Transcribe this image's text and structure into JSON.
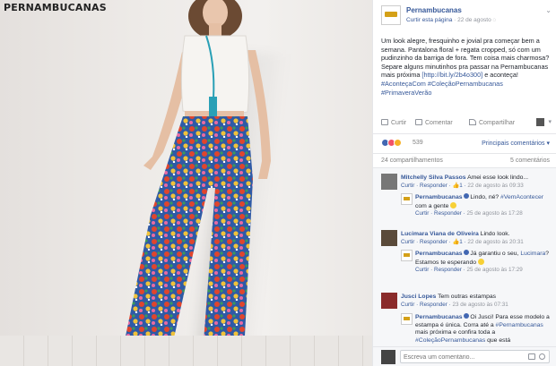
{
  "photo": {
    "watermark": "PERNAMBUCANAS"
  },
  "post": {
    "page_name": "Pernambucanas",
    "like_page": "Curtir esta página",
    "date": "22 de agosto",
    "text_main": "Um look alegre, fresquinho e jovial pra começar bem a semana. Pantalona floral + regata cropped, só com um pudinzinho da barriga de fora. Tem coisa mais charmosa? Separe alguns minutinhos pra passar na Pernambucanas mais próxima ",
    "link": "[http://bit.ly/2b4o300]",
    "text_mid": " e aconteça! ",
    "hashtags": "#AconteçaCom #ColeçãoPernambucanas #PrimaveraVerão"
  },
  "actions": {
    "like": "Curtir",
    "comment": "Comentar",
    "share": "Compartilhar"
  },
  "reactions": {
    "count": "539",
    "top_comments": "Principais comentários"
  },
  "counts": {
    "shares": "24 compartilhamentos",
    "comments": "5 comentários"
  },
  "comments": [
    {
      "name": "Mitchelly Silva Passos",
      "text": "Amei esse look lindo...",
      "like": "Curtir",
      "reply": "Responder",
      "likes": "1",
      "time": "22 de agosto às 09:33"
    },
    {
      "name": "Pernambucanas",
      "text": "Lindo, né? ",
      "mention": "#VemAcontecer",
      "text2": " com a gente ",
      "like": "Curtir",
      "reply": "Responder",
      "time": "25 de agosto às 17:28"
    },
    {
      "name": "Lucimara Viana de Oliveira",
      "text": "Lindo look.",
      "like": "Curtir",
      "reply": "Responder",
      "likes": "1",
      "time": "22 de agosto às 20:31"
    },
    {
      "name": "Pernambucanas",
      "text": "Já garantiu o seu, ",
      "mention": "Lucimara",
      "text2": "? Estamos te esperando ",
      "like": "Curtir",
      "reply": "Responder",
      "time": "25 de agosto às 17:29"
    },
    {
      "name": "Jusci Lopes",
      "text": "Tem outras estampas",
      "like": "Curtir",
      "reply": "Responder",
      "time": "23 de agosto às 07:31"
    },
    {
      "name": "Pernambucanas",
      "text": "Oi Jusci! Para esse modelo a estampa é única. Corra até a ",
      "mention": "#Pernambucanas",
      "text2": " mais próxima e confira toda a ",
      "mention2": "#ColeçãoPernambucanas",
      "text3": " que está"
    }
  ],
  "compose": {
    "placeholder": "Escreva um comentário..."
  },
  "colors": {
    "fb_blue": "#365899",
    "gray": "#90949c",
    "text": "#1d2129"
  }
}
